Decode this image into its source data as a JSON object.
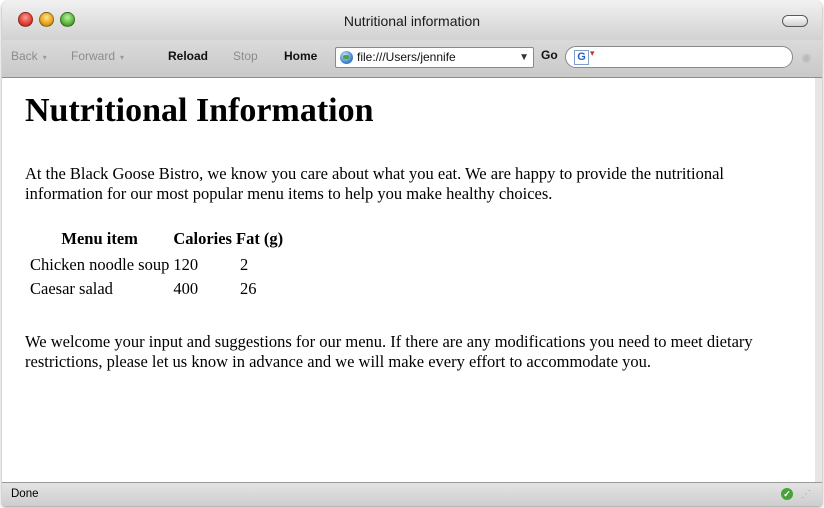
{
  "window": {
    "title": "Nutritional information"
  },
  "toolbar": {
    "back": "Back",
    "forward": "Forward",
    "reload": "Reload",
    "stop": "Stop",
    "home": "Home",
    "url": "file:///Users/jennife",
    "go": "Go"
  },
  "search": {
    "engine_icon": "G"
  },
  "page": {
    "heading": "Nutritional Information",
    "intro": "At the Black Goose Bistro, we know you care about what you eat. We are happy to provide the nutritional information for our most popular menu items to help you make healthy choices.",
    "table": {
      "headers": [
        "Menu item",
        "Calories",
        "Fat (g)"
      ],
      "rows": [
        [
          "Chicken noodle soup",
          "120",
          "2"
        ],
        [
          "Caesar salad",
          "400",
          "26"
        ]
      ]
    },
    "outro": "We welcome your input and suggestions for our menu. If there are any modifications you need to meet dietary restrictions, please let us know in advance and we will make every effort to accommodate you."
  },
  "statusbar": {
    "text": "Done"
  },
  "icons": {
    "globe": "globe-icon",
    "status": "check-icon",
    "loading": "spinner-icon"
  },
  "colors": {
    "status_ok": "#47a23a",
    "chrome_bg": "#d2d2d2"
  }
}
